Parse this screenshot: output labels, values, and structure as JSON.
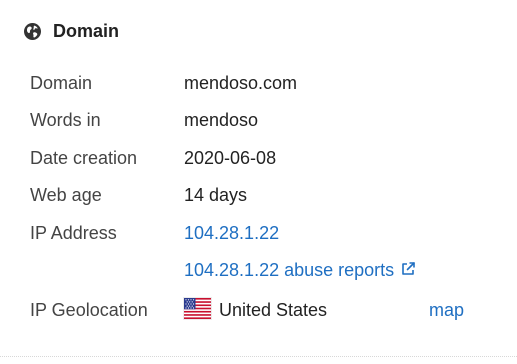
{
  "header": {
    "title": "Domain",
    "icon": "globe-icon"
  },
  "rows": {
    "domain": {
      "label": "Domain",
      "value": "mendoso.com"
    },
    "words_in": {
      "label": "Words in",
      "value": "mendoso"
    },
    "date_creation": {
      "label": "Date creation",
      "value": "2020-06-08"
    },
    "web_age": {
      "label": "Web age",
      "value": "14 days"
    },
    "ip_address": {
      "label": "IP Address",
      "value": "104.28.1.22"
    },
    "abuse": {
      "value": "104.28.1.22 abuse reports",
      "icon": "external-link-icon"
    },
    "geolocation": {
      "label": "IP Geolocation",
      "value": "United States",
      "flag": "us-flag-icon",
      "map_label": "map"
    }
  },
  "colors": {
    "link": "#1f6fc2",
    "label": "#444444",
    "text": "#222222"
  }
}
